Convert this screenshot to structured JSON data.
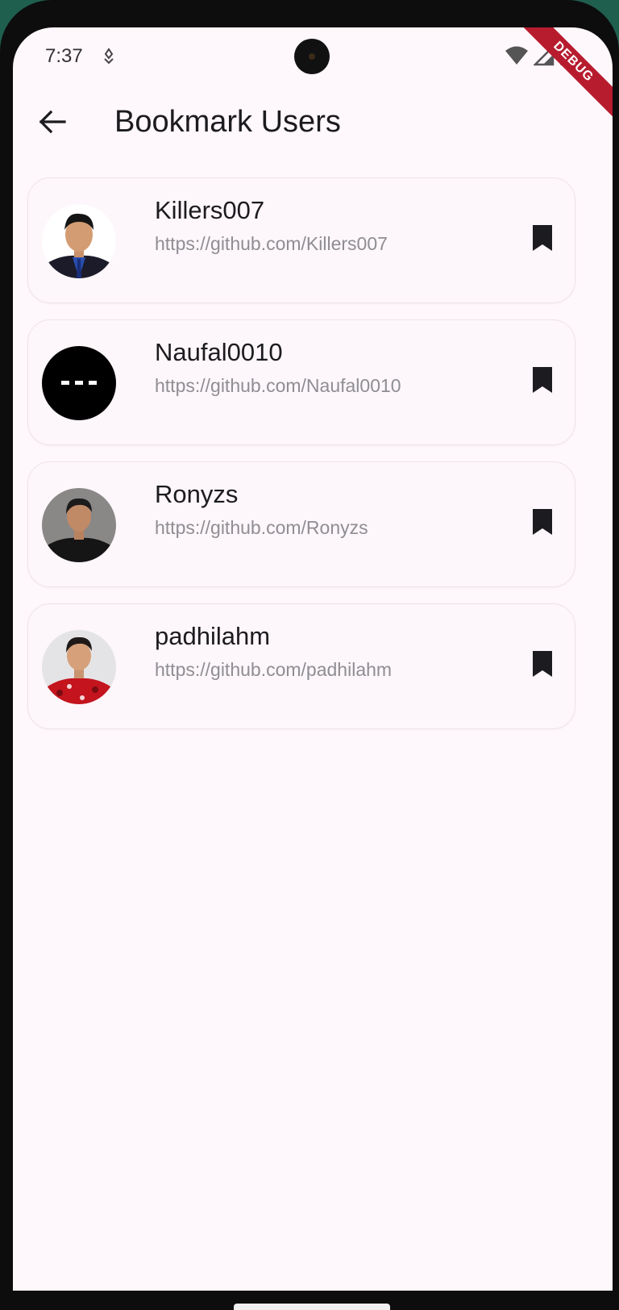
{
  "status_bar": {
    "time": "7:37",
    "notification_icon": "location-pin-icon",
    "icons": [
      "wifi-icon",
      "signal-icon",
      "battery-icon"
    ],
    "debug_label": "DEBUG"
  },
  "app_bar": {
    "back_icon": "arrow-left-icon",
    "title": "Bookmark Users"
  },
  "users": [
    {
      "name": "Killers007",
      "url": "https://github.com/Killers007",
      "avatar": "photo-man-suit",
      "bookmark_icon": "bookmark-filled-icon"
    },
    {
      "name": "Naufal0010",
      "url": "https://github.com/Naufal0010",
      "avatar": "black-dots",
      "bookmark_icon": "bookmark-filled-icon"
    },
    {
      "name": "Ronyzs",
      "url": "https://github.com/Ronyzs",
      "avatar": "photo-man-black-shirt",
      "bookmark_icon": "bookmark-filled-icon"
    },
    {
      "name": "padhilahm",
      "url": "https://github.com/padhilahm",
      "avatar": "photo-man-red-shirt",
      "bookmark_icon": "bookmark-filled-icon"
    }
  ],
  "colors": {
    "background": "#fef7fb",
    "card": "#fdf6fa",
    "text_primary": "#1c1b1f",
    "text_secondary": "#8e8e93",
    "debug_ribbon": "#b71c2e"
  }
}
